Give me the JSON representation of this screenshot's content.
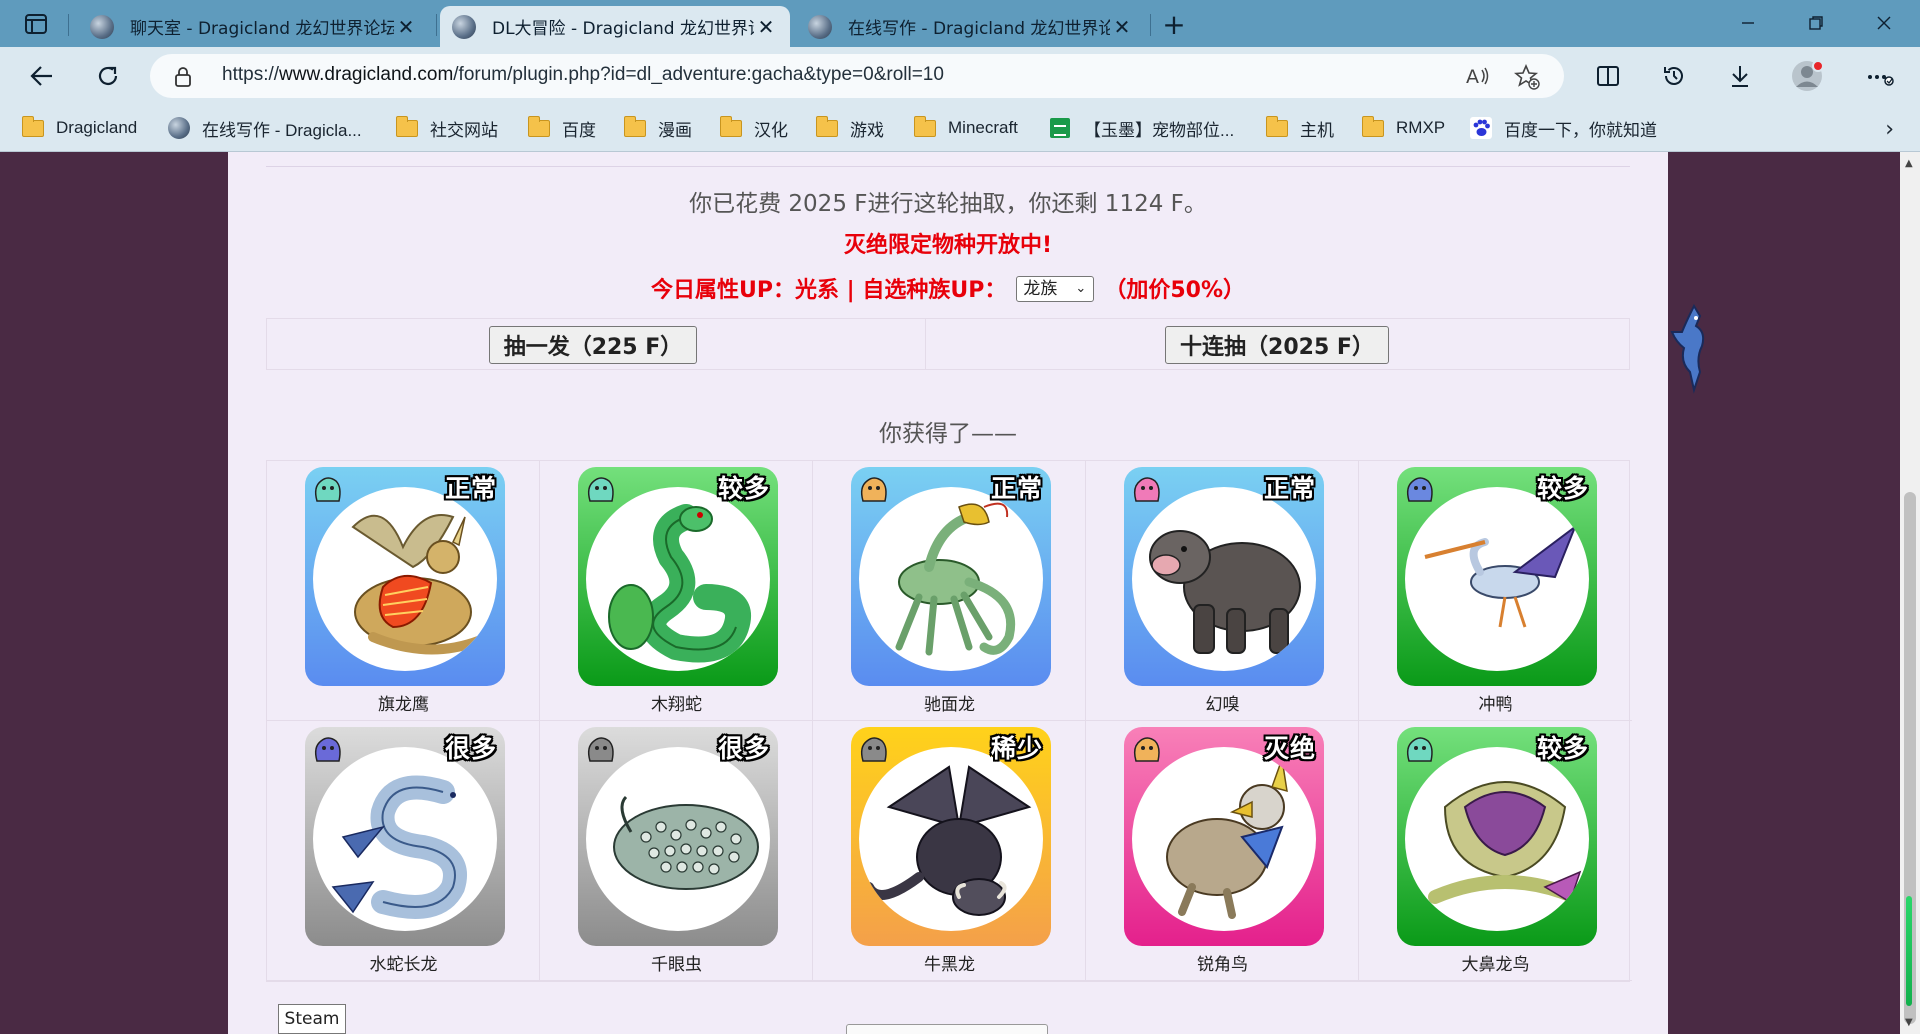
{
  "browser": {
    "tabs": [
      {
        "title": "聊天室 - Dragicland 龙幻世界论坛",
        "active": false
      },
      {
        "title": "DL大冒险 - Dragicland 龙幻世界论坛",
        "active": true
      },
      {
        "title": "在线写作 - Dragicland 龙幻世界论坛",
        "active": false
      }
    ],
    "url": {
      "scheme": "https://",
      "host": "www.dragicland.com",
      "path": "/forum/plugin.php?id=dl_adventure:gacha&type=0&roll=10"
    },
    "bookmarks": [
      {
        "label": "Dragicland",
        "icon": "folder-icon"
      },
      {
        "label": "在线写作 - Dragicla...",
        "icon": "globe-icon"
      },
      {
        "label": "社交网站",
        "icon": "folder-icon"
      },
      {
        "label": "百度",
        "icon": "folder-icon"
      },
      {
        "label": "漫画",
        "icon": "folder-icon"
      },
      {
        "label": "汉化",
        "icon": "folder-icon"
      },
      {
        "label": "游戏",
        "icon": "folder-icon"
      },
      {
        "label": "Minecraft",
        "icon": "folder-icon"
      },
      {
        "label": "【玉墨】宠物部位...",
        "icon": "sheets-icon"
      },
      {
        "label": "主机",
        "icon": "folder-icon"
      },
      {
        "label": "RMXP",
        "icon": "folder-icon"
      },
      {
        "label": "百度一下，你就知道",
        "icon": "baidu-paw-icon"
      }
    ]
  },
  "gacha": {
    "spent_line": "你已花费 2025 F进行这轮抽取，你还剩 1124 F。",
    "event_line": "灭绝限定物种开放中!",
    "up_prefix": "今日属性UP：光系 | 自选种族UP：",
    "race_selected": "龙族",
    "up_suffix": "（加价50%）",
    "single_button": "抽一发（225 F）",
    "ten_button": "十连抽（2025 F）",
    "result_heading": "你获得了——",
    "results": [
      {
        "name": "旗龙鹰",
        "rarity": "正常",
        "card_color": "blue",
        "element_color": "#6fd8c0"
      },
      {
        "name": "木翔蛇",
        "rarity": "较多",
        "card_color": "green",
        "element_color": "#6fd8c0"
      },
      {
        "name": "驰面龙",
        "rarity": "正常",
        "card_color": "blue",
        "element_color": "#f0b25a"
      },
      {
        "name": "幻嗅",
        "rarity": "正常",
        "card_color": "blue",
        "element_color": "#f07ab8"
      },
      {
        "name": "冲鸭",
        "rarity": "较多",
        "card_color": "green",
        "element_color": "#6a88e0"
      },
      {
        "name": "水蛇长龙",
        "rarity": "很多",
        "card_color": "gray",
        "element_color": "#6a6ad8"
      },
      {
        "name": "千眼虫",
        "rarity": "很多",
        "card_color": "gray",
        "element_color": "#8a8a8a"
      },
      {
        "name": "牛黑龙",
        "rarity": "稀少",
        "card_color": "gold",
        "element_color": "#8a8a8a"
      },
      {
        "name": "锐角鸟",
        "rarity": "灭绝",
        "card_color": "pink",
        "element_color": "#f0b25a"
      },
      {
        "name": "大鼻龙鸟",
        "rarity": "较多",
        "card_color": "green",
        "element_color": "#6fd8c0"
      }
    ]
  },
  "tooltip": {
    "text": "Steam"
  }
}
